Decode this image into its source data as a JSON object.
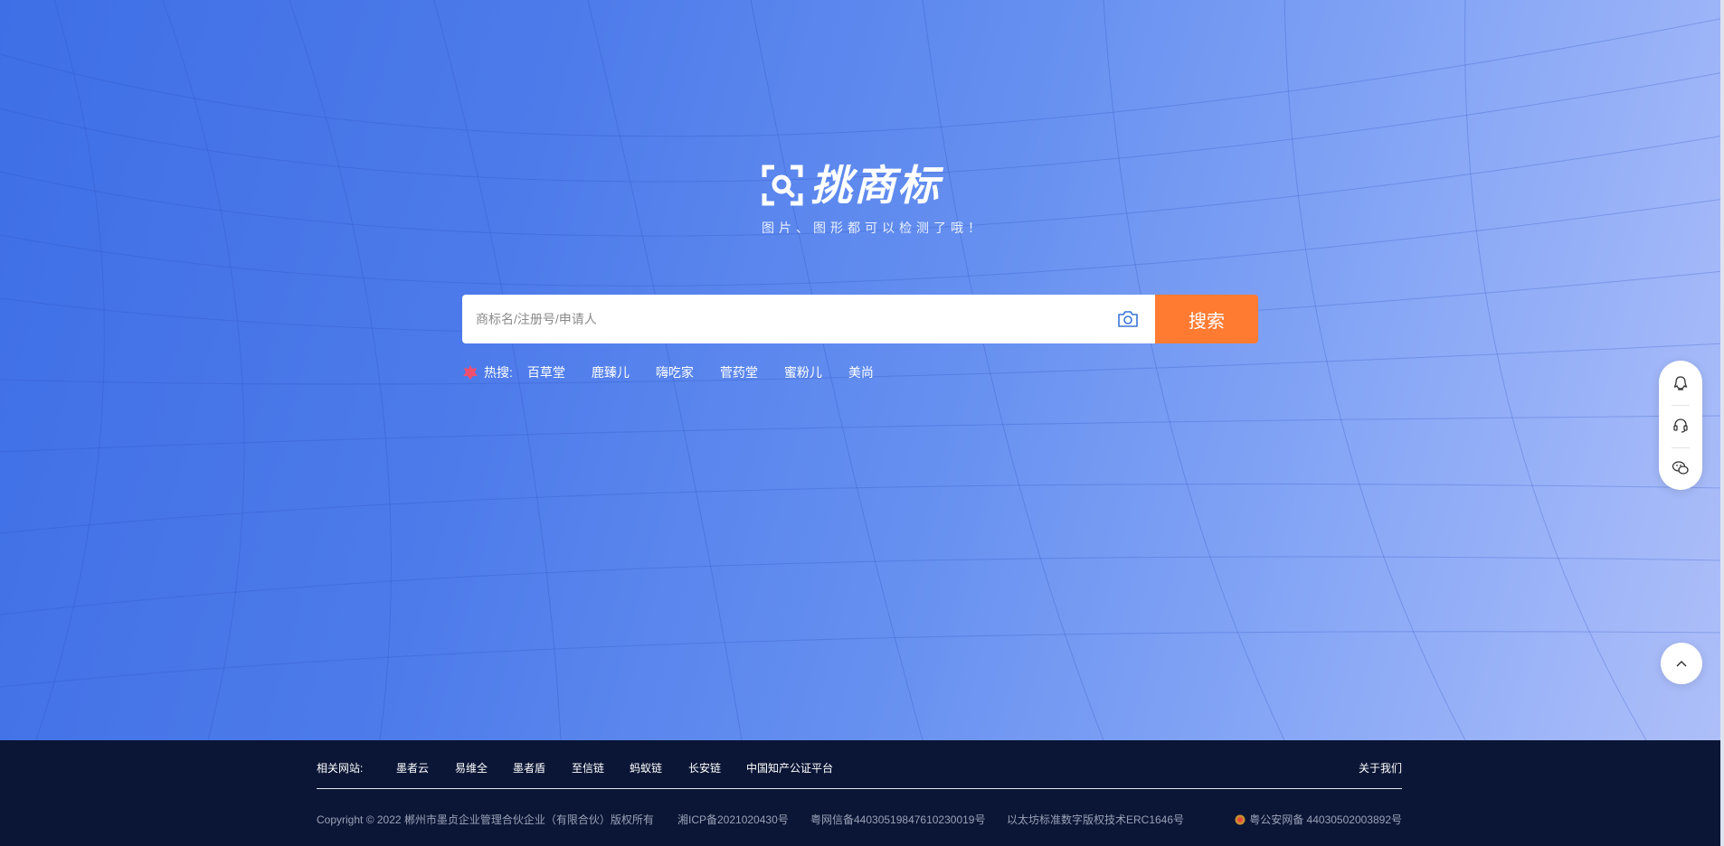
{
  "brand": {
    "name": "挑商标",
    "slogan": "图片、图形都可以检测了哦！"
  },
  "search": {
    "placeholder": "商标名/注册号/申请人",
    "value": "",
    "button_label": "搜索",
    "camera_icon": "camera-icon"
  },
  "hot": {
    "label": "热搜:",
    "items": [
      "百草堂",
      "鹿臻儿",
      "嗨吃家",
      "菅药堂",
      "蜜粉儿",
      "美尚"
    ]
  },
  "side_toolbar": {
    "items": [
      "qq-icon",
      "customer-service-icon",
      "wechat-icon"
    ],
    "back_to_top": "chevron-up-icon"
  },
  "footer": {
    "related_label": "相关网站:",
    "links": [
      "墨者云",
      "易维全",
      "墨者盾",
      "至信链",
      "蚂蚁链",
      "长安链",
      "中国知产公证平台"
    ],
    "about": "关于我们",
    "copyright": "Copyright © 2022 郴州市墨贞企业管理合伙企业（有限合伙）版权所有",
    "icp": "湘ICP备2021020430号",
    "telecom": "粤网信备44030519847610230019号",
    "blockchain": "以太坊标准数字版权技术ERC1646号",
    "police": "粤公安网备 44030502003892号"
  },
  "colors": {
    "hero_blue": "#4d7bea",
    "search_orange": "#ff7b32",
    "footer_navy": "#0b1636"
  }
}
